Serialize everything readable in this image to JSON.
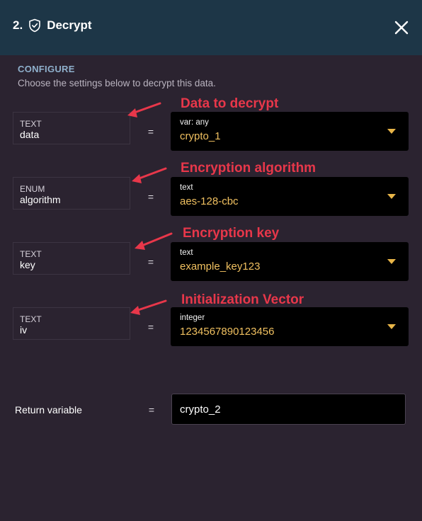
{
  "header": {
    "step": "2.",
    "title": "Decrypt",
    "icon": "shield-check-icon",
    "close_icon": "close-icon",
    "background": "#1d3647"
  },
  "section": {
    "heading": "CONFIGURE",
    "description": "Choose the settings below to decrypt this data."
  },
  "params": [
    {
      "type": "TEXT",
      "name": "data",
      "equals": "=",
      "value_type": "var: any",
      "value": "crypto_1",
      "annotation": "Data to decrypt"
    },
    {
      "type": "ENUM",
      "name": "algorithm",
      "equals": "=",
      "value_type": "text",
      "value": "aes-128-cbc",
      "annotation": "Encryption algorithm"
    },
    {
      "type": "TEXT",
      "name": "key",
      "equals": "=",
      "value_type": "text",
      "value": "example_key123",
      "annotation": "Encryption key"
    },
    {
      "type": "TEXT",
      "name": "iv",
      "equals": "=",
      "value_type": "integer",
      "value": "1234567890123456",
      "annotation": "Initialization Vector"
    }
  ],
  "return_variable": {
    "label": "Return variable",
    "equals": "=",
    "value": "crypto_2"
  },
  "colors": {
    "panel_bg": "#2b2330",
    "value_text": "#f0c060",
    "annotation": "#e8374a",
    "heading": "#8fb0cc"
  }
}
